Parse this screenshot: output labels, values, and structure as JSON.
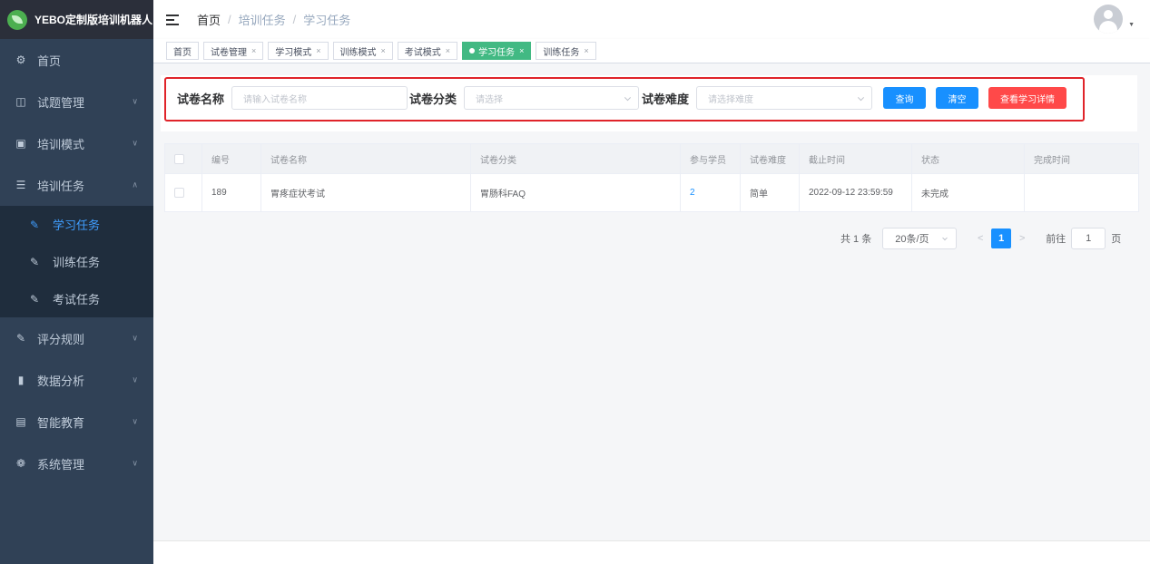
{
  "app": {
    "title": "YEBO定制版培训机器人"
  },
  "sidebar": {
    "items": [
      {
        "label": "首页",
        "icon": "dashboard-icon"
      },
      {
        "label": "试题管理",
        "icon": "book-icon"
      },
      {
        "label": "培训模式",
        "icon": "monitor-icon"
      },
      {
        "label": "培训任务",
        "icon": "list-icon"
      },
      {
        "label": "评分规则",
        "icon": "edit-icon"
      },
      {
        "label": "数据分析",
        "icon": "chart-icon"
      },
      {
        "label": "智能教育",
        "icon": "screen-icon"
      },
      {
        "label": "系统管理",
        "icon": "gear-icon"
      }
    ],
    "submenu": [
      {
        "label": "学习任务",
        "icon": "edit-icon",
        "active": true
      },
      {
        "label": "训练任务",
        "icon": "edit-icon"
      },
      {
        "label": "考试任务",
        "icon": "edit-icon"
      }
    ]
  },
  "breadcrumb": [
    "首页",
    "/",
    "培训任务",
    "/",
    "学习任务"
  ],
  "tags": [
    {
      "label": "首页",
      "closable": false
    },
    {
      "label": "试卷管理",
      "closable": true
    },
    {
      "label": "学习模式",
      "closable": true
    },
    {
      "label": "训练模式",
      "closable": true
    },
    {
      "label": "考试模式",
      "closable": true
    },
    {
      "label": "学习任务",
      "closable": true,
      "active": true
    },
    {
      "label": "训练任务",
      "closable": true
    }
  ],
  "tag_close_glyph": "×",
  "search": {
    "name_label": "试卷名称",
    "name_placeholder": "请输入试卷名称",
    "category_label": "试卷分类",
    "category_placeholder": "请选择",
    "difficulty_label": "试卷难度",
    "difficulty_placeholder": "请选择难度",
    "query_button": "查询",
    "clear_button": "清空",
    "detail_button": "查看学习详情"
  },
  "table": {
    "headers": [
      "编号",
      "试卷名称",
      "试卷分类",
      "参与学员",
      "试卷难度",
      "截止时间",
      "状态",
      "完成时间"
    ],
    "rows": [
      [
        "189",
        "胃疼症状考试",
        "胃肠科FAQ",
        "2",
        "简单",
        "2022-09-12 23:59:59",
        "未完成",
        ""
      ]
    ]
  },
  "pagination": {
    "total": "共 1 条",
    "page_size": "20条/页",
    "prev": "<",
    "current": "1",
    "next": ">",
    "goto_label": "前往",
    "goto_value": "1",
    "page_suffix": "页"
  },
  "colors": {
    "sidebar_bg": "#304156",
    "active_tag": "#42b983",
    "primary": "#1890ff",
    "danger": "#ff4949",
    "highlight_frame": "#e0242a"
  }
}
